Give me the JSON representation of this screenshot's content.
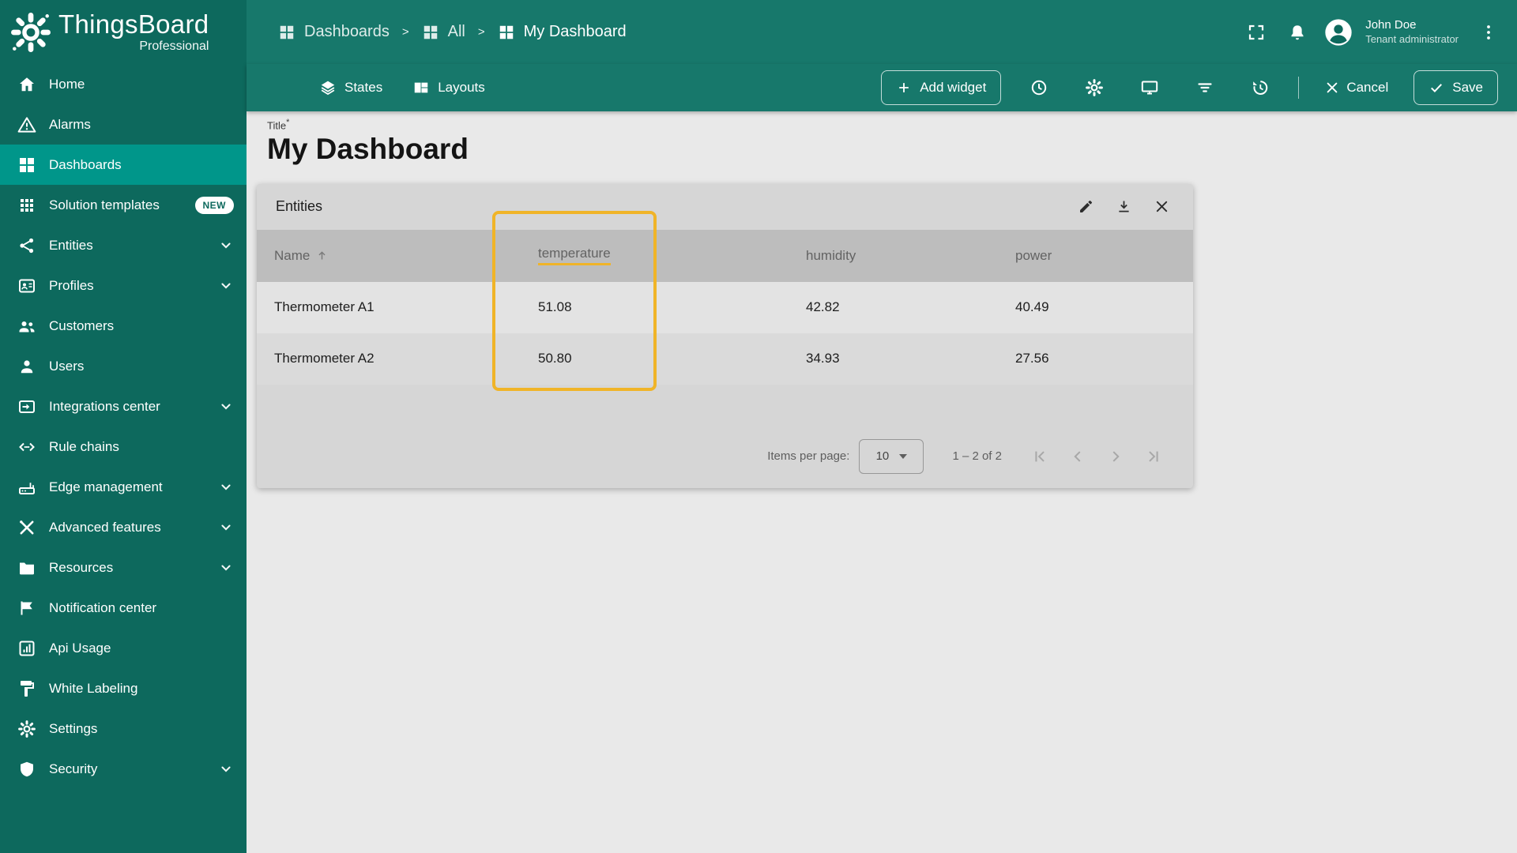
{
  "brand": {
    "name": "ThingsBoard",
    "edition": "Professional"
  },
  "sidebar": {
    "items": [
      {
        "label": "Home"
      },
      {
        "label": "Alarms"
      },
      {
        "label": "Dashboards",
        "selected": true
      },
      {
        "label": "Solution templates",
        "badge": "NEW"
      },
      {
        "label": "Entities",
        "expandable": true
      },
      {
        "label": "Profiles",
        "expandable": true
      },
      {
        "label": "Customers"
      },
      {
        "label": "Users"
      },
      {
        "label": "Integrations center",
        "expandable": true
      },
      {
        "label": "Rule chains"
      },
      {
        "label": "Edge management",
        "expandable": true
      },
      {
        "label": "Advanced features",
        "expandable": true
      },
      {
        "label": "Resources",
        "expandable": true
      },
      {
        "label": "Notification center"
      },
      {
        "label": "Api Usage"
      },
      {
        "label": "White Labeling"
      },
      {
        "label": "Settings"
      },
      {
        "label": "Security",
        "expandable": true
      }
    ]
  },
  "breadcrumb": {
    "separator": ">",
    "items": [
      "Dashboards",
      "All",
      "My Dashboard"
    ]
  },
  "user": {
    "name": "John Doe",
    "role": "Tenant administrator"
  },
  "toolbar": {
    "states_label": "States",
    "layouts_label": "Layouts",
    "add_widget_label": "Add widget",
    "cancel_label": "Cancel",
    "save_label": "Save"
  },
  "page": {
    "title_label": "Title",
    "required_mark": "*",
    "title": "My Dashboard"
  },
  "widget": {
    "title": "Entities",
    "table": {
      "columns": [
        "Name",
        "temperature",
        "humidity",
        "power"
      ],
      "sort": {
        "column": "Name",
        "direction": "asc"
      },
      "rows": [
        [
          "Thermometer A1",
          "51.08",
          "42.82",
          "40.49"
        ],
        [
          "Thermometer A2",
          "50.80",
          "34.93",
          "27.56"
        ]
      ]
    },
    "pagination": {
      "items_per_page_label": "Items per page:",
      "items_per_page_value": "10",
      "range_label": "1 – 2 of 2"
    }
  },
  "colors": {
    "header_bg": "#17786b",
    "sidebar_bg": "#0d695d",
    "selected_item_bg": "#00968a",
    "highlight": "#f0b428",
    "main_bg": "#e9e9e9",
    "card_bg": "#d6d6d6",
    "table_header_bg": "#bdbdbd"
  }
}
